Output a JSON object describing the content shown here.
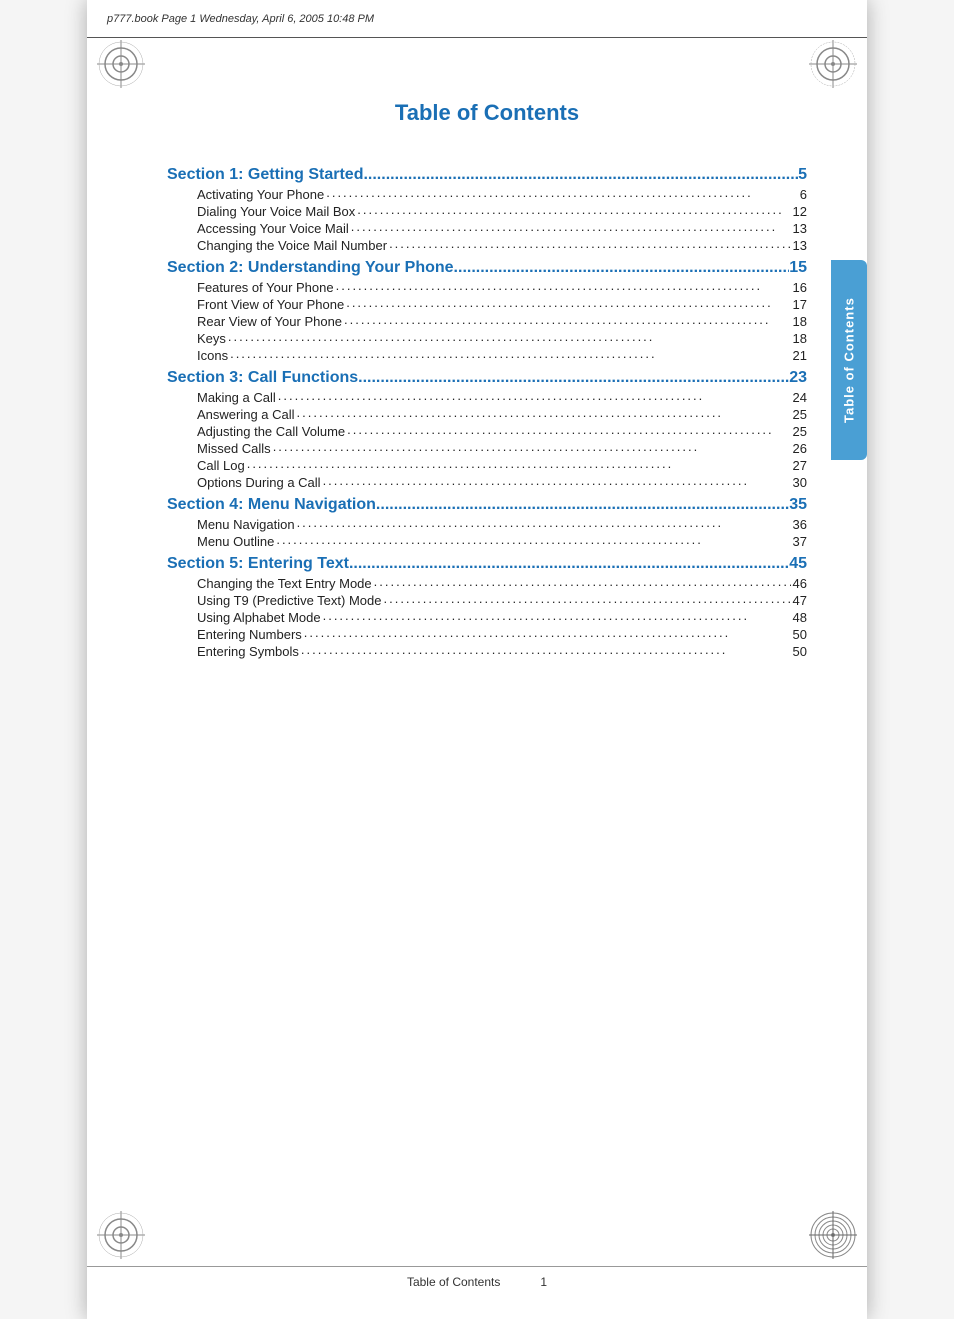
{
  "header": {
    "text": "p777.book  Page 1  Wednesday, April 6, 2005  10:48 PM"
  },
  "page_title": "Table of Contents",
  "side_tab": {
    "label": "Table of Contents"
  },
  "toc": {
    "sections": [
      {
        "title": "Section 1: Getting Started",
        "page": "5",
        "subsections": [
          {
            "title": "Activating Your Phone",
            "page": "6"
          },
          {
            "title": "Dialing Your Voice Mail Box",
            "page": "12"
          },
          {
            "title": "Accessing Your Voice Mail",
            "page": "13"
          },
          {
            "title": "Changing the Voice Mail Number",
            "page": "13"
          }
        ]
      },
      {
        "title": "Section 2: Understanding Your Phone",
        "page": "15",
        "subsections": [
          {
            "title": "Features of Your Phone",
            "page": "16"
          },
          {
            "title": "Front View of Your Phone",
            "page": "17"
          },
          {
            "title": "Rear View of Your Phone",
            "page": "18"
          },
          {
            "title": "Keys",
            "page": "18"
          },
          {
            "title": "Icons",
            "page": "21"
          }
        ]
      },
      {
        "title": "Section 3: Call Functions",
        "page": "23",
        "subsections": [
          {
            "title": "Making a Call",
            "page": "24"
          },
          {
            "title": "Answering a Call",
            "page": "25"
          },
          {
            "title": "Adjusting the Call Volume",
            "page": "25"
          },
          {
            "title": "Missed Calls",
            "page": "26"
          },
          {
            "title": "Call Log",
            "page": "27"
          },
          {
            "title": "Options During a Call",
            "page": "30"
          }
        ]
      },
      {
        "title": "Section 4: Menu Navigation",
        "page": "35",
        "subsections": [
          {
            "title": "Menu Navigation",
            "page": "36"
          },
          {
            "title": "Menu Outline",
            "page": "37"
          }
        ]
      },
      {
        "title": "Section 5: Entering Text",
        "page": "45",
        "subsections": [
          {
            "title": "Changing the Text Entry Mode",
            "page": "46"
          },
          {
            "title": "Using T9 (Predictive Text) Mode",
            "page": "47"
          },
          {
            "title": "Using Alphabet Mode",
            "page": "48"
          },
          {
            "title": "Entering Numbers",
            "page": "50"
          },
          {
            "title": "Entering Symbols",
            "page": "50"
          }
        ]
      }
    ]
  },
  "footer": {
    "label": "Table of Contents",
    "page_number": "1"
  },
  "colors": {
    "blue": "#1a6fb5",
    "tab_blue": "#4a9fd4"
  }
}
